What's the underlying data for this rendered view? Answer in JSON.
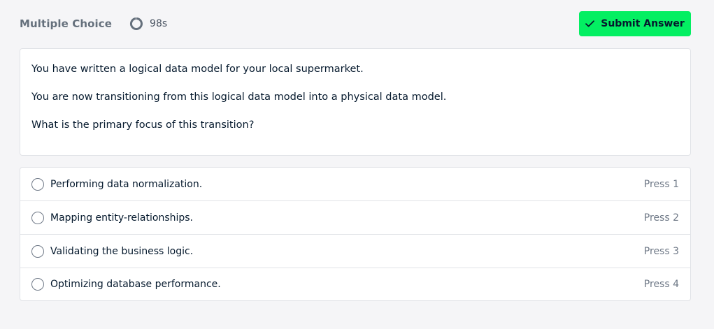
{
  "header": {
    "title": "Multiple Choice",
    "timer_text": "98s",
    "timer_icon": "timer-ring-icon",
    "submit_label": "Submit Answer",
    "submit_icon": "checkmark-icon",
    "accent_color": "#03ef62"
  },
  "question": {
    "paragraphs": [
      "You have written a logical data model for your local supermarket.",
      "You are now transitioning from this logical data model into a physical data model.",
      "What is the primary focus of this transition?"
    ]
  },
  "options": [
    {
      "label": "Performing data normalization.",
      "shortcut": "Press 1"
    },
    {
      "label": "Mapping entity-relationships.",
      "shortcut": "Press 2"
    },
    {
      "label": "Validating the business logic.",
      "shortcut": "Press 3"
    },
    {
      "label": "Optimizing database performance.",
      "shortcut": "Press 4"
    }
  ]
}
